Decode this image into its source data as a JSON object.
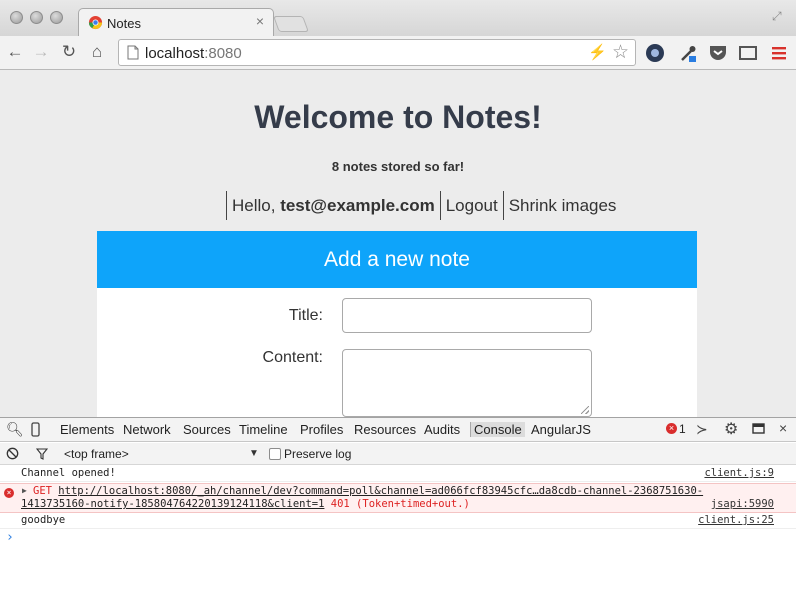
{
  "browser": {
    "tab_title": "Notes",
    "tab_close": "×",
    "url_host": "localhost",
    "url_port": ":8080"
  },
  "page": {
    "heading": "Welcome to Notes!",
    "notes_count_text": "8 notes stored so far!",
    "hello_prefix": "Hello, ",
    "user_email": "test@example.com",
    "logout_label": "Logout",
    "shrink_label": "Shrink images",
    "add_note_header": "Add a new note",
    "title_label": "Title:",
    "title_value": "",
    "content_label": "Content:",
    "content_value": "",
    "accent_color": "#0ea4fa"
  },
  "devtools": {
    "tabs": [
      "Elements",
      "Network",
      "Sources",
      "Timeline",
      "Profiles",
      "Resources",
      "Audits",
      "Console",
      "AngularJS"
    ],
    "active_tab": "Console",
    "error_count": "1",
    "frame_select": "<top frame>",
    "preserve_log_label": "Preserve log",
    "logs": [
      {
        "message": "Channel opened!",
        "source": "client.js:9"
      },
      {
        "method": "GET",
        "url_line1": "http://localhost:8080/_ah/channel/dev?command=poll&channel=ad066fcf83945cfc…da8cdb-channel-2368751630-",
        "url_line2": "1413735160-notify-1858047642201391241​18&client=1",
        "status": "401 (Token+timed+out.)",
        "source": "jsapi:5990"
      },
      {
        "message": "goodbye",
        "source": "client.js:25"
      }
    ],
    "prompt": "›"
  }
}
